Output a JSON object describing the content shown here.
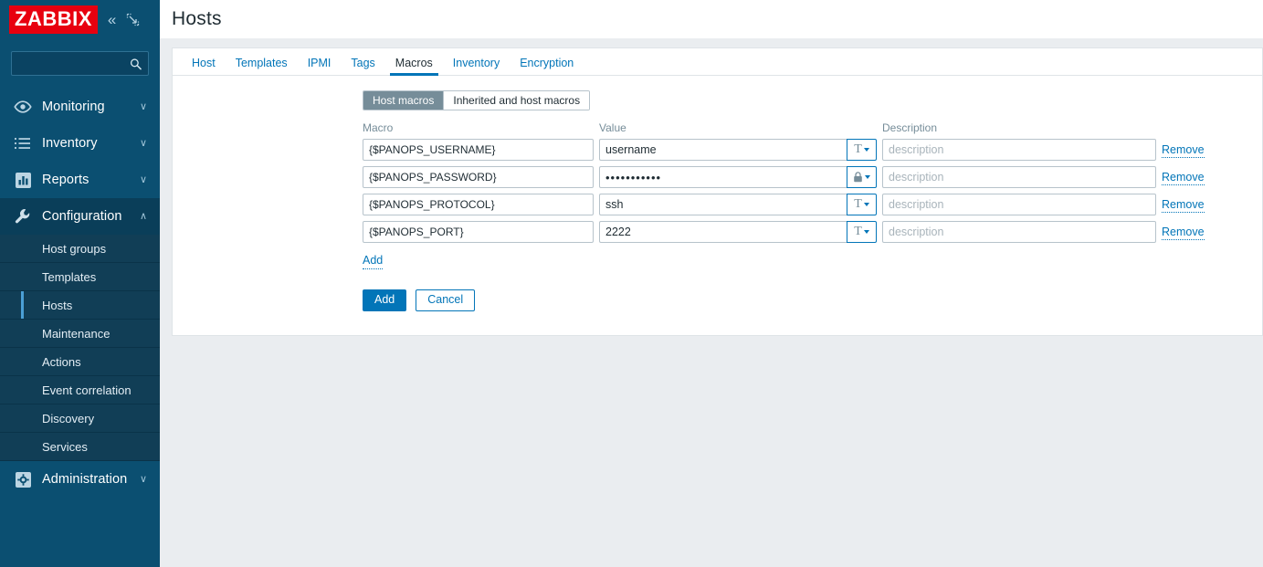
{
  "brand": {
    "logo_text": "ZABBIX",
    "logo_bg": "#e8000f",
    "sidebar_bg": "#0b4f71",
    "accent": "#0275b8"
  },
  "sidebar": {
    "collapse_icon": "chevrons-left-icon",
    "compact_icon": "collapse-panel-icon",
    "search": {
      "value": "",
      "placeholder": ""
    },
    "items": [
      {
        "label": "Monitoring",
        "icon": "eye-icon",
        "chevron": "chevron-down-icon",
        "expanded": false
      },
      {
        "label": "Inventory",
        "icon": "list-icon",
        "chevron": "chevron-down-icon",
        "expanded": false
      },
      {
        "label": "Reports",
        "icon": "bar-chart-icon",
        "chevron": "chevron-down-icon",
        "expanded": false
      },
      {
        "label": "Configuration",
        "icon": "wrench-icon",
        "chevron": "chevron-up-icon",
        "expanded": true
      },
      {
        "label": "Administration",
        "icon": "gear-icon",
        "chevron": "chevron-down-icon",
        "expanded": false
      }
    ],
    "configuration_submenu": [
      {
        "label": "Host groups",
        "active": false
      },
      {
        "label": "Templates",
        "active": false
      },
      {
        "label": "Hosts",
        "active": true
      },
      {
        "label": "Maintenance",
        "active": false
      },
      {
        "label": "Actions",
        "active": false
      },
      {
        "label": "Event correlation",
        "active": false
      },
      {
        "label": "Discovery",
        "active": false
      },
      {
        "label": "Services",
        "active": false
      }
    ]
  },
  "header": {
    "title": "Hosts"
  },
  "tabs": [
    {
      "label": "Host",
      "active": false
    },
    {
      "label": "Templates",
      "active": false
    },
    {
      "label": "IPMI",
      "active": false
    },
    {
      "label": "Tags",
      "active": false
    },
    {
      "label": "Macros",
      "active": true
    },
    {
      "label": "Inventory",
      "active": false
    },
    {
      "label": "Encryption",
      "active": false
    }
  ],
  "macro_scope": {
    "options": [
      {
        "label": "Host macros",
        "selected": true
      },
      {
        "label": "Inherited and host macros",
        "selected": false
      }
    ]
  },
  "table": {
    "headers": {
      "macro": "Macro",
      "value": "Value",
      "description": "Description"
    },
    "rows": [
      {
        "macro": "{$PANOPS_USERNAME}",
        "value": "username",
        "value_masked": false,
        "type_icon": "text-type-icon",
        "type_glyph": "T",
        "description": "",
        "description_placeholder": "description",
        "remove_label": "Remove"
      },
      {
        "macro": "{$PANOPS_PASSWORD}",
        "value": "•••••••••••",
        "value_masked": true,
        "type_icon": "secret-lock-icon",
        "type_glyph": "lock",
        "description": "",
        "description_placeholder": "description",
        "remove_label": "Remove"
      },
      {
        "macro": "{$PANOPS_PROTOCOL}",
        "value": "ssh",
        "value_masked": false,
        "type_icon": "text-type-icon",
        "type_glyph": "T",
        "description": "",
        "description_placeholder": "description",
        "remove_label": "Remove"
      },
      {
        "macro": "{$PANOPS_PORT}",
        "value": "2222",
        "value_masked": false,
        "type_icon": "text-type-icon",
        "type_glyph": "T",
        "description": "",
        "description_placeholder": "description",
        "remove_label": "Remove"
      }
    ],
    "add_row_label": "Add"
  },
  "footer": {
    "submit_label": "Add",
    "cancel_label": "Cancel"
  }
}
